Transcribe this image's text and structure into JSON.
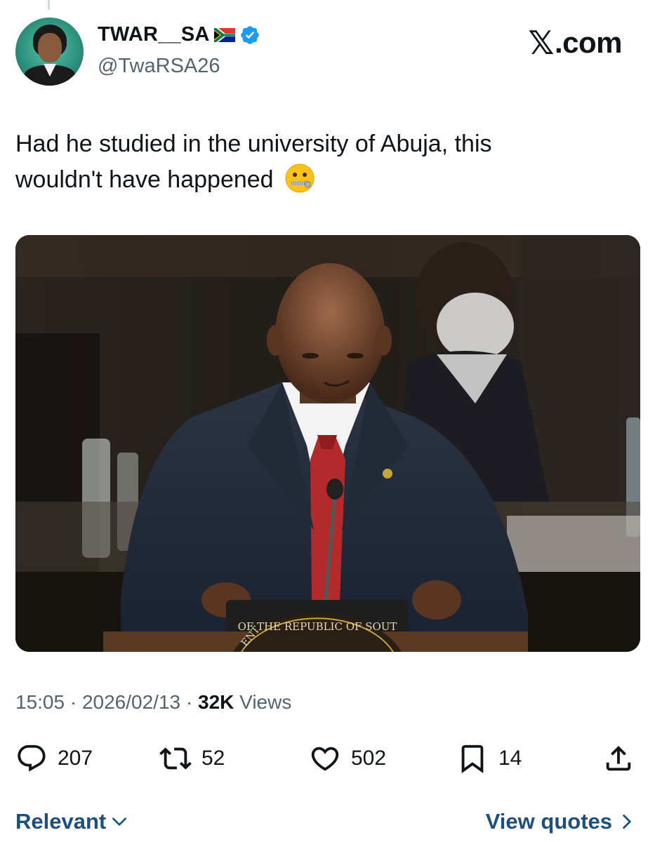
{
  "author": {
    "display_name": "TWAR__SA",
    "handle": "@TwaRSA26",
    "verified": true,
    "flag_icon": "south-africa-flag-icon",
    "avatar_icon": "profile-avatar"
  },
  "brand": {
    "label_rest": ".com",
    "label_x": "𝕏"
  },
  "tweet": {
    "text_line1": "Had he studied in the university of Abuja, this",
    "text_line2": "wouldn't have happened",
    "emoji": "zipper-mouth-face-icon"
  },
  "media": {
    "alt_icon": "photo-man-at-podium",
    "podium_text": "OF THE REPUBLIC OF SOUT",
    "podium_text_left": "ENT"
  },
  "meta": {
    "time": "15:05",
    "sep1": " · ",
    "date": "2026/02/13",
    "sep2": " · ",
    "views_count": "32K",
    "views_label": " Views"
  },
  "actions": {
    "replies": "207",
    "reposts": "52",
    "likes": "502",
    "bookmarks": "14"
  },
  "footer": {
    "sort_label": "Relevant",
    "quotes_label": "View quotes"
  },
  "colors": {
    "verified": "#1d9bf0",
    "link": "#1d4f7c",
    "secondary_text": "#536471",
    "tie": "#b22a2a"
  }
}
